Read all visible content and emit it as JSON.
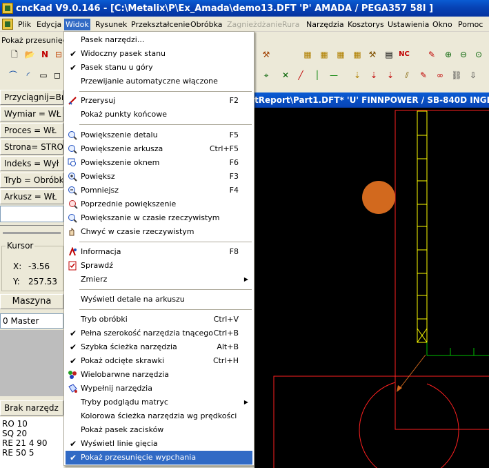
{
  "titlebar": {
    "title": "cncKad V9.0.146 - [C:\\Metalix\\P\\Ex_Amada\\demo13.DFT  'P'  AMADA / PEGA357   58I  ]"
  },
  "menubar": {
    "items": [
      "Plik",
      "Edycja",
      "Widok",
      "Rysunek",
      "Przekształcenie",
      "Obróbka",
      "Zagnieżdżanie",
      "Rura",
      "Narzędzia",
      "Kosztorys",
      "Ustawienia",
      "Okno",
      "Pomoc"
    ]
  },
  "hint_text": "Pokaż przesunięcie",
  "left_panel": {
    "buttons": [
      "Przyciągnij=Br",
      "Wymiar = WŁ",
      "Proces = WŁ",
      "Strona= STRO",
      "Indeks = Wył",
      "Tryb = Obróbk",
      "Arkusz = WŁ"
    ],
    "kursor_label": "Kursor",
    "x_label": "X:",
    "x_value": "-3.56",
    "y_label": "Y:",
    "y_value": "257.53",
    "maszyna": "Maszyna",
    "master_field": "0 Master",
    "brak": "Brak narzędz",
    "ncode": [
      "RO 10",
      "SQ 20",
      "RE 21 4 90",
      "RE 50 5"
    ]
  },
  "document_title": "tReport\\Part1.DFT*  'U'  FINNPOWER / SB-840D   INGEN",
  "menu": {
    "items": [
      {
        "label": "Pasek narzędzi...",
        "shortcut": "",
        "check": false
      },
      {
        "label": "Widoczny pasek stanu",
        "shortcut": "",
        "check": true
      },
      {
        "label": "Pasek stanu u góry",
        "shortcut": "",
        "check": true
      },
      {
        "label": "Przewijanie automatyczne włączone",
        "shortcut": "",
        "check": false
      },
      {
        "label": "Przerysuj",
        "shortcut": "F2",
        "icon": "redraw-icon"
      },
      {
        "label": "Pokaż punkty końcowe",
        "shortcut": ""
      },
      {
        "label": "Powiększenie detalu",
        "shortcut": "F5",
        "icon": "zoom-part-icon"
      },
      {
        "label": "Powiększenie arkusza",
        "shortcut": "Ctrl+F5",
        "icon": "zoom-sheet-icon"
      },
      {
        "label": "Powiększenie oknem",
        "shortcut": "F6",
        "icon": "zoom-window-icon"
      },
      {
        "label": "Powiększ",
        "shortcut": "F3",
        "icon": "zoom-in-icon"
      },
      {
        "label": "Pomniejsz",
        "shortcut": "F4",
        "icon": "zoom-out-icon"
      },
      {
        "label": "Poprzednie powiększenie",
        "shortcut": "",
        "icon": "zoom-previous-icon"
      },
      {
        "label": "Powiększanie w czasie rzeczywistym",
        "shortcut": "",
        "icon": "zoom-realtime-icon"
      },
      {
        "label": "Chwyć w czasie rzeczywistym",
        "shortcut": "",
        "icon": "pan-realtime-icon"
      },
      {
        "label": "Informacja",
        "shortcut": "F8",
        "icon": "info-icon"
      },
      {
        "label": "Sprawdź",
        "shortcut": "",
        "icon": "check-icon"
      },
      {
        "label": "Zmierz",
        "shortcut": "",
        "submenu": true
      },
      {
        "label": "Wyświetl detale na arkuszu",
        "shortcut": ""
      },
      {
        "label": "Tryb obróbki",
        "shortcut": "Ctrl+V"
      },
      {
        "label": "Pełna szerokość narzędzia tnącego",
        "shortcut": "Ctrl+B",
        "check": true
      },
      {
        "label": "Szybka ścieżka narzędzia",
        "shortcut": "Alt+B",
        "check": true
      },
      {
        "label": "Pokaż odcięte skrawki",
        "shortcut": "Ctrl+H",
        "check": true
      },
      {
        "label": "Wielobarwne narzędzia",
        "shortcut": "",
        "icon": "multicolor-tools-icon"
      },
      {
        "label": "Wypełnij narzędzia",
        "shortcut": "",
        "icon": "fill-tools-icon"
      },
      {
        "label": "Tryby podglądu matryc",
        "shortcut": "",
        "submenu": true
      },
      {
        "label": "Kolorowa ścieżka narzędzia wg prędkości",
        "shortcut": ""
      },
      {
        "label": "Pokaż pasek zacisków",
        "shortcut": ""
      },
      {
        "label": "Wyświetl linie gięcia",
        "shortcut": "",
        "check": true
      },
      {
        "label": "Pokaż przesunięcie wypchania",
        "shortcut": "",
        "check": true,
        "highlighted": true
      }
    ]
  },
  "colors": {
    "accent": "#316ac5",
    "title_blue": "#0743b5",
    "canvas": "#000000",
    "part_red": "#ff2020",
    "punch_orange": "#d2691e",
    "yellow_line": "#ffff00",
    "green_line": "#00c000"
  },
  "toolbar1_glyphs": [
    "new-icon",
    "open-icon",
    "nc-icon",
    "print-icon"
  ],
  "toolbar1_right_nc": "NC"
}
